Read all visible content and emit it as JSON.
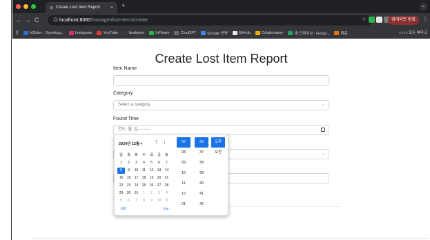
{
  "browser": {
    "tab_title": "Create Lost Item Report",
    "tab_close": "×",
    "new_tab": "+",
    "url_host": "localhost:8080",
    "url_path": "/manager/lost-items/create",
    "profile_label": "업데이트 완료",
    "back": "←",
    "forward": "→",
    "reload": "C",
    "star": "☆",
    "kebab": "⋮",
    "tab_menu": "⌄"
  },
  "bookmarks": {
    "items": [
      {
        "label": "h01dev - Synology...",
        "color": "#2d6cdf"
      },
      {
        "label": "Instagram",
        "color": "#d6336c"
      },
      {
        "label": "YouTube",
        "color": "#e53935"
      },
      {
        "label": "beakjoon",
        "color": "#3a3a3a"
      },
      {
        "label": "InFlearn",
        "color": "#2fb24c"
      },
      {
        "label": "ChatGPT",
        "color": "#6b6b6b"
      },
      {
        "label": "Google 번역",
        "color": "#4285f4"
      },
      {
        "label": "GitHub",
        "color": "#e8e8e8"
      },
      {
        "label": "Colaboratory",
        "color": "#f9ab00"
      },
      {
        "label": "내 드라이브 - Googl...",
        "color": "#1fa463"
      },
      {
        "label": "취준",
        "color": "#e8710a"
      }
    ],
    "right_label": "모든 북마크",
    "overflow": "»"
  },
  "page": {
    "title": "Create Lost Item Report",
    "item_name_label": "Item Name",
    "item_name_value": "",
    "category_label": "Category",
    "category_placeholder": "Select a category",
    "found_time_label": "Found Time",
    "found_time_placeholder": "연도. 월. 일. -- --:--"
  },
  "datepicker": {
    "month_label": "2024년 12월 ▾",
    "nav_up": "↑",
    "nav_down": "↓",
    "weekdays": [
      "일",
      "월",
      "화",
      "수",
      "목",
      "금",
      "토"
    ],
    "weeks": [
      [
        "1",
        "2",
        "3",
        "4",
        "5",
        "6",
        "7"
      ],
      [
        "8",
        "9",
        "10",
        "11",
        "12",
        "13",
        "14"
      ],
      [
        "15",
        "16",
        "17",
        "18",
        "19",
        "20",
        "21"
      ],
      [
        "22",
        "23",
        "24",
        "25",
        "26",
        "27",
        "28"
      ],
      [
        "29",
        "30",
        "31",
        "1",
        "2",
        "3",
        "4"
      ],
      [
        "5",
        "6",
        "7",
        "8",
        "9",
        "10",
        "11"
      ]
    ],
    "selected_day": "8",
    "clear_label": "삭제",
    "today_label": "오늘",
    "hours": [
      "07",
      "08",
      "09",
      "10",
      "11",
      "12",
      "01"
    ],
    "minutes": [
      "36",
      "37",
      "38",
      "39",
      "40",
      "41",
      "42"
    ],
    "ampm": [
      "오후",
      "오전"
    ]
  }
}
